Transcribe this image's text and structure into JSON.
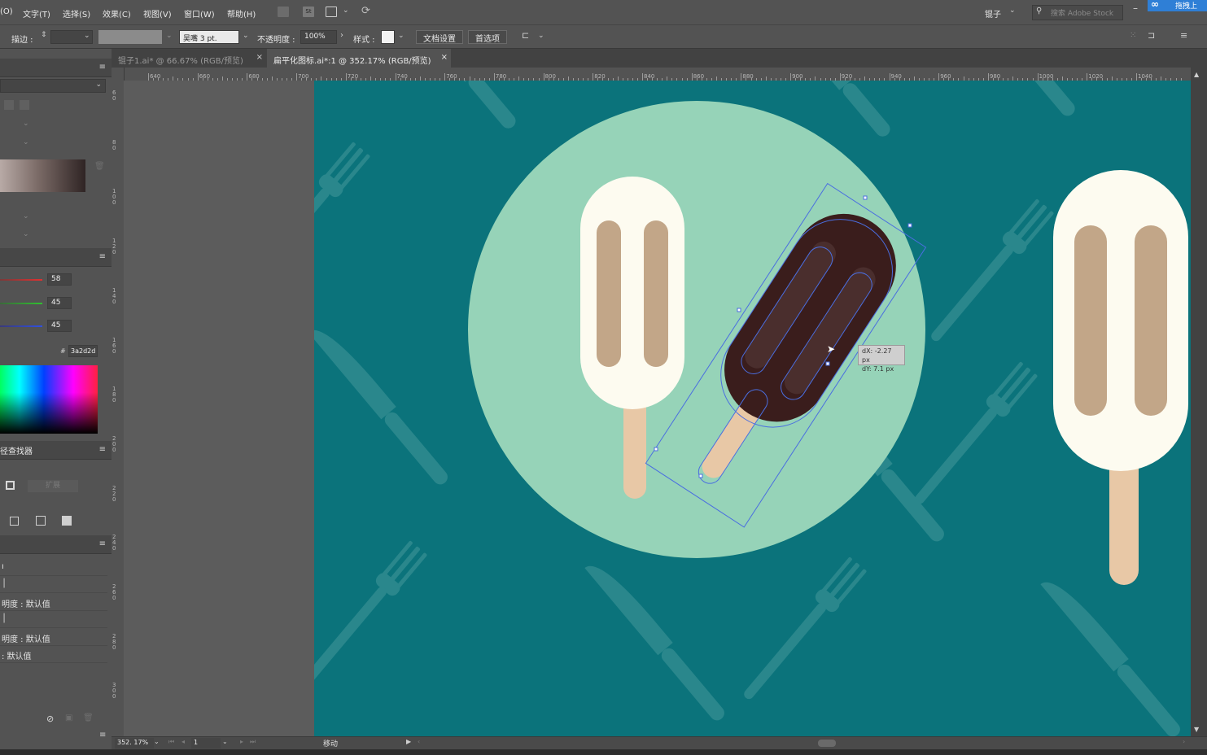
{
  "menubar": {
    "items": [
      "(O)",
      "文字(T)",
      "选择(S)",
      "效果(C)",
      "视图(V)",
      "窗口(W)",
      "帮助(H)"
    ],
    "workspace": "锟子",
    "search_placeholder": "搜索 Adobe Stock",
    "cloud_label": "拖拽上"
  },
  "control": {
    "stroke_label": "描边 :",
    "brush_value": "吴嘴 3 pt.",
    "opacity_label": "不透明度 :",
    "opacity_value": "100%",
    "style_label": "样式 :",
    "doc_setup": "文档设置",
    "preferences": "首选项"
  },
  "tabs": [
    {
      "label": "锟子1.ai* @ 66.67% (RGB/预览)",
      "active": false
    },
    {
      "label": "扁平化图标.ai*:1 @ 352.17% (RGB/预览)",
      "active": true
    }
  ],
  "ruler": {
    "h_ticks": [
      "640",
      "660",
      "680",
      "700",
      "720",
      "740",
      "760",
      "780",
      "800",
      "820",
      "840",
      "860",
      "880",
      "900",
      "920",
      "940",
      "960",
      "980",
      "1000",
      "1020",
      "1040"
    ],
    "v_ticks": [
      "60",
      "80",
      "100",
      "120",
      "140",
      "160",
      "180",
      "200",
      "220",
      "240",
      "260",
      "280",
      "300"
    ]
  },
  "color_panel": {
    "r": "58",
    "g": "45",
    "b": "45",
    "hex": "3a2d2d",
    "hash": "#"
  },
  "pathfinder": {
    "title": "径查找器",
    "expand_label": "扩展"
  },
  "appearance": {
    "rows": [
      "ı",
      "│",
      "明度 : 默认值",
      "│",
      "明度 : 默认值",
      ": 默认值"
    ]
  },
  "transform_tip": {
    "dx": "dX: -2.27 px",
    "dy": "dY: 7.1 px"
  },
  "status": {
    "zoom": "352. 17%",
    "artboard_num": "1",
    "tool": "移动"
  },
  "colors": {
    "artboard_bg": "#0b737b",
    "plate": "#96d3b8",
    "cream": "#fdfbf0",
    "stripe": "#c2a688",
    "stick": "#e8c8a6",
    "chocolate": "#3a1d1c",
    "selection": "#4a6ee0"
  }
}
